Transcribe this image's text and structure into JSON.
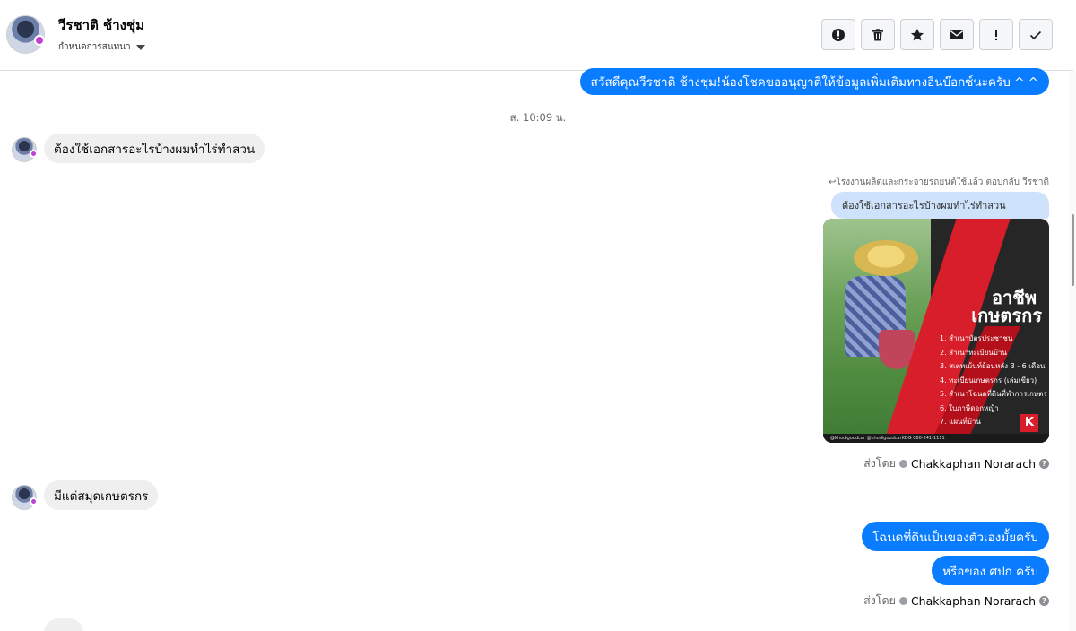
{
  "header": {
    "contact_name": "วีรชาติ ช้างชุ่ม",
    "assign_label": "กำหนดการสนทนา"
  },
  "toolbar": [
    {
      "name": "spam-button",
      "icon": "alert-circle-icon"
    },
    {
      "name": "delete-button",
      "icon": "trash-icon"
    },
    {
      "name": "star-button",
      "icon": "star-icon"
    },
    {
      "name": "mark-unread-button",
      "icon": "envelope-icon"
    },
    {
      "name": "important-button",
      "icon": "exclamation-icon"
    },
    {
      "name": "done-button",
      "icon": "check-icon"
    }
  ],
  "messages": {
    "greeting": "สวัสดีคุณวีรชาติ ช้างชุ่ม!น้องโชคขออนุญาติให้ข้อมูลเพิ่มเติมทางอินบ๊อกซ์นะครับ ^ ^",
    "timestamp": "ส. 10:09 น.",
    "incoming_1": "ต้องใช้เอกสารอะไรบ้างผมทำไร่ทำสวน",
    "reply_note": "โรงงานผลิตและกระจายรถยนต์ใช้แล้ว ตอบกลับ วีรชาติ",
    "reply_quote": "ต้องใช้เอกสารอะไรบ้างผมทำไร่ทำสวน",
    "sent_by_prefix": "ส่งโดย",
    "sent_by_name": "Chakkaphan Norarach",
    "incoming_2": "มีแต่สมุดเกษตรกร",
    "outgoing_1": "โฉนดที่ดินเป็นของตัวเองมั้ยครับ",
    "outgoing_2": "หรือของ ศปก ครับ"
  },
  "poster": {
    "title_line1": "อาชีพ",
    "title_line2": "เกษตรกร",
    "items": [
      "1. สำเนาบัตรประชาชน",
      "2. สำเนาทะเบียนบ้าน",
      "3. สเตทเม้นท์ย้อนหลัง 3 - 6 เดือน",
      "4. ทะเบียนเกษตรกร (เล่มเขียว)",
      "5. สำเนาโฉนดที่ดินที่ทำการเกษตร",
      "6. ใบภาษีดอกหญ้า",
      "7. แผนที่บ้าน"
    ],
    "footer": "@khodigoodcar   @khodigoodcarKDG   080-241-1111",
    "logo": "K"
  }
}
